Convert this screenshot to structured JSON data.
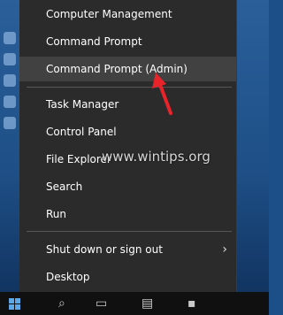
{
  "menu": {
    "items": [
      {
        "label": "Computer Management"
      },
      {
        "label": "Command Prompt"
      },
      {
        "label": "Command Prompt (Admin)"
      },
      {
        "label": "Task Manager"
      },
      {
        "label": "Control Panel"
      },
      {
        "label": "File Explorer"
      },
      {
        "label": "Search"
      },
      {
        "label": "Run"
      },
      {
        "label": "Shut down or sign out"
      },
      {
        "label": "Desktop"
      }
    ],
    "submenu_chevron": "›"
  },
  "watermark": "www.wintips.org",
  "icons": {
    "start": "windows-logo-icon",
    "search": "search-icon",
    "task_view": "task-view-icon",
    "explorer": "folder-icon",
    "pin": "pin-icon"
  },
  "colors": {
    "menu_bg": "#2b2b2b",
    "highlight_bg": "#414141",
    "annotation_arrow": "#e8232a"
  }
}
